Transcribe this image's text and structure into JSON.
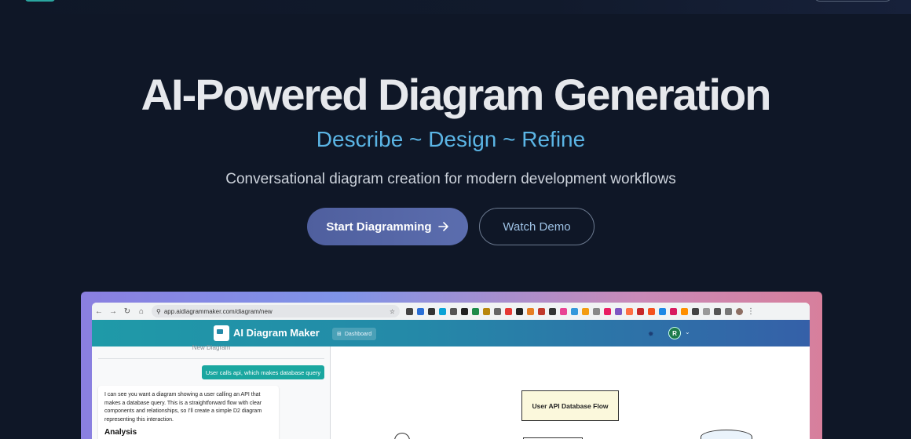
{
  "hero": {
    "title": "AI-Powered Diagram Generation",
    "subtitle": "Describe ~ Design ~ Refine",
    "tagline": "Conversational diagram creation for modern development workflows",
    "primary_cta": "Start Diagramming",
    "primary_cta_icon": "arrow-right-icon",
    "secondary_cta": "Watch Demo"
  },
  "browser": {
    "url": "app.aidiagrammaker.com/diagram/new",
    "nav_icons": [
      "back-icon",
      "forward-icon",
      "reload-icon",
      "home-icon"
    ]
  },
  "app": {
    "name": "AI Diagram Maker",
    "dashboard_label": "Dashboard",
    "avatar_initial": "R"
  },
  "chat": {
    "title": "New Diagram",
    "user_message": "User calls api, which makes database query",
    "ai_message": "I can see you want a diagram showing a user calling an API that makes a database query. This is a straightforward flow with clear components and relationships, so I'll create a simple D2 diagram representing this interaction.",
    "ai_heading": "Analysis"
  },
  "diagram": {
    "title": "User API Database Flow"
  },
  "colors": {
    "page_bg": "#0f1727",
    "title": "#e6e8ec",
    "subtitle": "#5bb5e5",
    "primary_button": "#5564a5",
    "app_header_start": "#1f9aa8",
    "app_header_end": "#3560a8",
    "user_bubble": "#1aa7a0",
    "diagram_title_bg": "#fbf8dc"
  }
}
